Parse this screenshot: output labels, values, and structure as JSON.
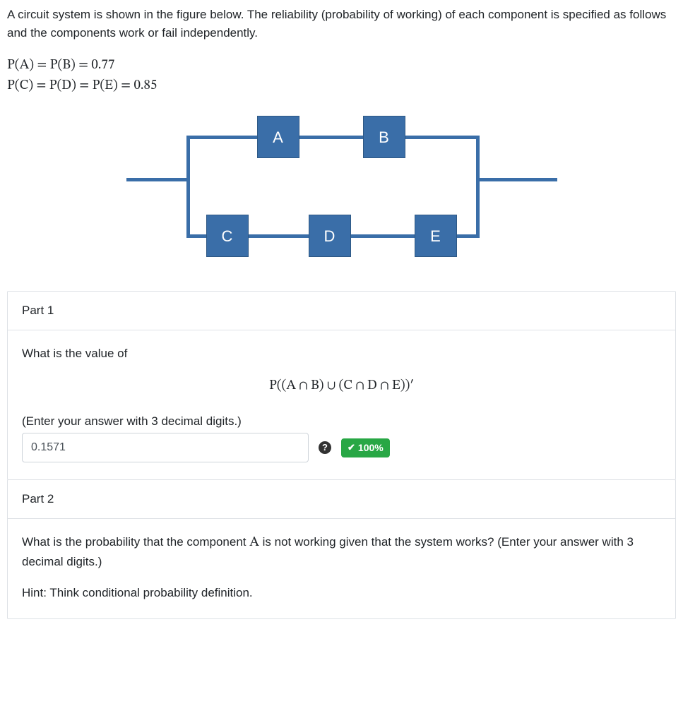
{
  "intro": "A circuit system is shown in the figure below. The reliability (probability of working) of each component is specified as follows and the components work or fail independently.",
  "prob_line1": "P(A) = P(B) = 0.77",
  "prob_line2": "P(C) = P(D) = P(E) = 0.85",
  "components": {
    "A": "A",
    "B": "B",
    "C": "C",
    "D": "D",
    "E": "E"
  },
  "part1": {
    "title": "Part 1",
    "prompt": "What is the value of",
    "expression": "P((A ∩ B) ∪ (C ∩ D ∩ E))′",
    "instruction": "(Enter your answer with 3 decimal digits.)",
    "answer": "0.1571",
    "score": "100%"
  },
  "part2": {
    "title": "Part 2",
    "question_pre": "What is the probability that the component ",
    "question_var": "A",
    "question_post": " is not working given that the system works? (Enter your answer with 3 decimal digits.)",
    "hint": "Hint: Think conditional probability definition."
  }
}
